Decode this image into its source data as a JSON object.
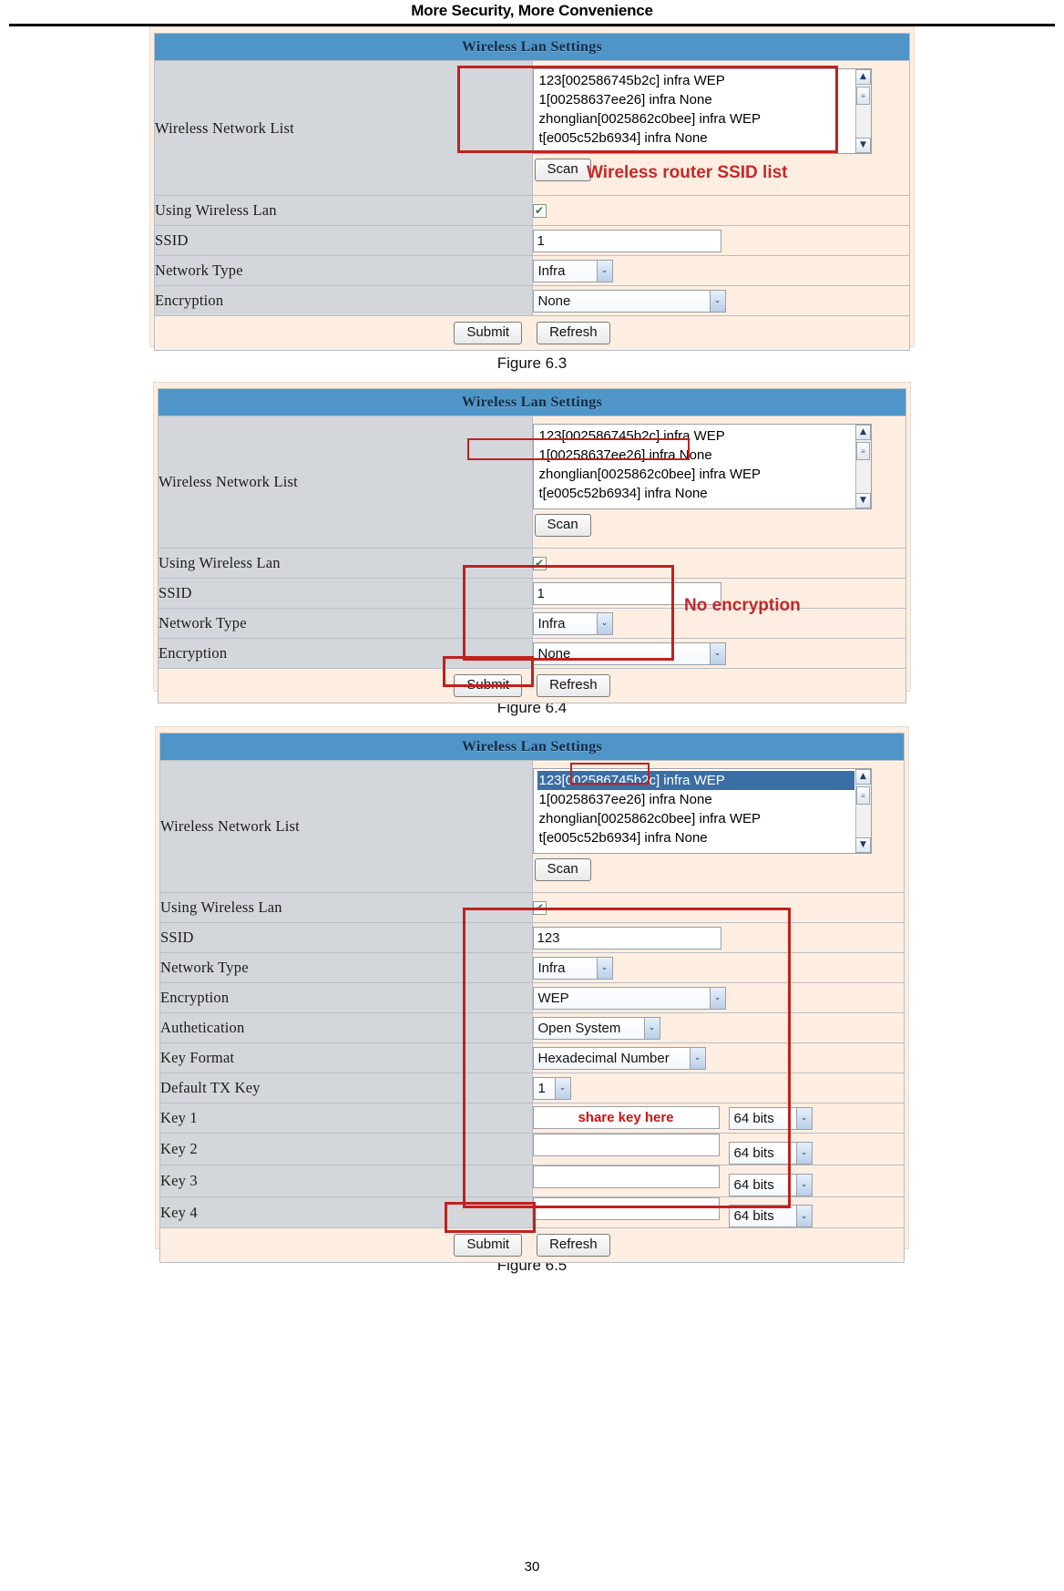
{
  "header": {
    "title": "More Security, More Convenience"
  },
  "footer": {
    "page_number": "30"
  },
  "common": {
    "panel_title": "Wireless Lan Settings",
    "labels": {
      "wireless_network_list": "Wireless Network List",
      "using_wireless_lan": "Using Wireless Lan",
      "ssid": "SSID",
      "network_type": "Network Type",
      "encryption": "Encryption",
      "authentication": "Authetication",
      "key_format": "Key Format",
      "default_tx_key": "Default TX Key",
      "key1": "Key 1",
      "key2": "Key 2",
      "key3": "Key 3",
      "key4": "Key 4"
    },
    "buttons": {
      "scan": "Scan",
      "submit": "Submit",
      "refresh": "Refresh"
    },
    "checkbox_glyph": "✔",
    "caret_glyph": "⌄",
    "scroll_up_glyph": "▲",
    "scroll_down_glyph": "▼",
    "accent_blue": "#4f95c8",
    "annotation_red": "#c62828",
    "row_label_bg": "#d3d7db",
    "panel_bg": "#fdeee1"
  },
  "figures": [
    {
      "caption": "Figure 6.3",
      "network_list": [
        {
          "text": "123[002586745b2c] infra WEP",
          "selected": false
        },
        {
          "text": "1[00258637ee26] infra None",
          "selected": false
        },
        {
          "text": "zhonglian[0025862c0bee] infra WEP",
          "selected": false
        },
        {
          "text": "t[e005c52b6934] infra None",
          "selected": false
        }
      ],
      "using_wireless_lan_checked": true,
      "ssid_value": "1",
      "network_type_value": "Infra",
      "encryption_value": "None",
      "annotation": "Wireless router SSID list"
    },
    {
      "caption": "Figure 6.4",
      "network_list": [
        {
          "text": "123[002586745b2c] infra WEP",
          "selected": false
        },
        {
          "text": "1[00258637ee26] infra None",
          "selected": false
        },
        {
          "text": "zhonglian[0025862c0bee] infra WEP",
          "selected": false
        },
        {
          "text": "t[e005c52b6934] infra None",
          "selected": false
        }
      ],
      "using_wireless_lan_checked": true,
      "ssid_value": "1",
      "network_type_value": "Infra",
      "encryption_value": "None",
      "annotation": "No encryption"
    },
    {
      "caption": "Figure 6.5",
      "network_list": [
        {
          "text": "123[002586745b2c] infra WEP",
          "selected": true
        },
        {
          "text": "1[00258637ee26] infra None",
          "selected": false
        },
        {
          "text": "zhonglian[0025862c0bee] infra WEP",
          "selected": false
        },
        {
          "text": "t[e005c52b6934] infra None",
          "selected": false
        }
      ],
      "using_wireless_lan_checked": true,
      "ssid_value": "123",
      "network_type_value": "Infra",
      "encryption_value": "WEP",
      "authentication_value": "Open System",
      "key_format_value": "Hexadecimal Number",
      "default_tx_key_value": "1",
      "keys": [
        {
          "value": "share key here",
          "bits": "64 bits",
          "is_annotation": true
        },
        {
          "value": "",
          "bits": "64 bits",
          "is_annotation": false
        },
        {
          "value": "",
          "bits": "64 bits",
          "is_annotation": false
        },
        {
          "value": "",
          "bits": "64 bits",
          "is_annotation": false
        }
      ],
      "annotation": "share key here"
    }
  ]
}
